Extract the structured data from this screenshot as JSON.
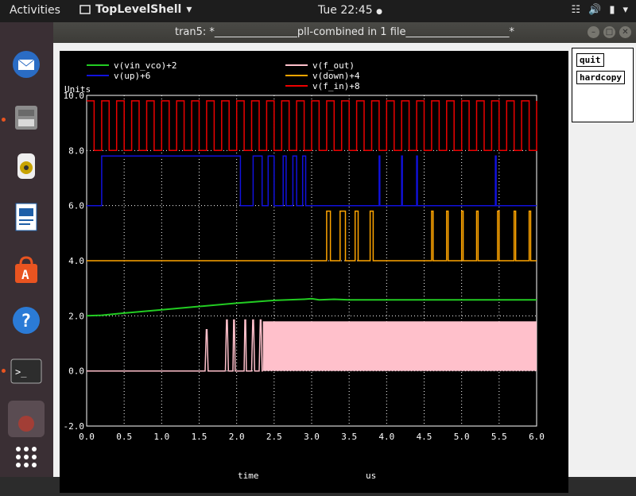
{
  "topbar": {
    "activities": "Activities",
    "app_name": "TopLevelShell",
    "clock": "Tue 22:45"
  },
  "dock": {
    "items": [
      "thunderbird-icon",
      "files-icon",
      "rhythmbox-icon",
      "libreoffice-writer-icon",
      "software-center-icon",
      "help-icon",
      "terminal-icon",
      "app-icon",
      "show-apps-icon"
    ]
  },
  "window": {
    "title": "tran5: *________________pll-combined in 1 file____________________*",
    "buttons": {
      "quit": "quit",
      "hardcopy": "hardcopy"
    }
  },
  "chart_data": {
    "type": "line",
    "ylabel": "Units",
    "xlabel": "time",
    "xunit": "us",
    "xlim": [
      0.0,
      6.0
    ],
    "ylim": [
      -2.0,
      10.0
    ],
    "x_ticks": [
      "0.0",
      "0.5",
      "1.0",
      "1.5",
      "2.0",
      "2.5",
      "3.0",
      "3.5",
      "4.0",
      "4.5",
      "5.0",
      "5.5",
      "6.0"
    ],
    "y_ticks": [
      "-2.0",
      "0.0",
      "2.0",
      "4.0",
      "6.0",
      "8.0",
      "10.0"
    ],
    "grid": true,
    "series": [
      {
        "name": "v(vin_vco)+2",
        "color": "#22cc22"
      },
      {
        "name": "v(up)+6",
        "color": "#1111dd"
      },
      {
        "name": "v(f_out)",
        "color": "#ffc0cb"
      },
      {
        "name": "v(down)+4",
        "color": "#ffa500"
      },
      {
        "name": "v(f_in)+8",
        "color": "#ee0000"
      }
    ],
    "vin_vco": {
      "x": [
        0,
        0.2,
        0.5,
        1.0,
        1.5,
        2.0,
        2.5,
        2.9,
        3.0,
        3.1,
        3.3,
        3.5,
        4.0,
        5.0,
        6.0
      ],
      "y": [
        2.0,
        2.02,
        2.1,
        2.22,
        2.34,
        2.46,
        2.56,
        2.6,
        2.62,
        2.58,
        2.6,
        2.58,
        2.58,
        2.58,
        2.58
      ]
    },
    "f_in": {
      "low": 8.0,
      "high": 9.8,
      "period_us": 0.2
    },
    "up": {
      "low": 6.0,
      "high": 7.8,
      "high_intervals": [
        [
          0.2,
          2.05
        ],
        [
          2.22,
          2.34
        ],
        [
          2.42,
          2.5
        ],
        [
          2.62,
          2.66
        ],
        [
          2.75,
          2.8
        ],
        [
          2.88,
          2.92
        ]
      ],
      "low_intervals": [
        [
          2.98,
          3.0
        ]
      ],
      "spikes": [
        3.9,
        4.2,
        4.4,
        5.45
      ]
    },
    "down": {
      "low": 4.0,
      "high": 5.8,
      "pulses": [
        [
          3.2,
          3.25
        ],
        [
          3.38,
          3.45
        ],
        [
          3.58,
          3.62
        ],
        [
          3.78,
          3.82
        ],
        [
          4.6,
          4.62
        ],
        [
          4.8,
          4.82
        ],
        [
          5.0,
          5.02
        ],
        [
          5.2,
          5.22
        ],
        [
          5.48,
          5.5
        ],
        [
          5.7,
          5.72
        ],
        [
          5.9,
          5.92
        ]
      ]
    },
    "f_out": {
      "low": 0.0,
      "high": 1.8,
      "isolated_pulses": [
        [
          1.58,
          1.62,
          1.5
        ],
        [
          1.85,
          1.89,
          1.85
        ],
        [
          1.95,
          1.98,
          1.85
        ],
        [
          2.1,
          2.13,
          1.85
        ],
        [
          2.2,
          2.24,
          1.85
        ],
        [
          2.3,
          2.34,
          1.85
        ]
      ],
      "dense_start": 2.35
    }
  }
}
